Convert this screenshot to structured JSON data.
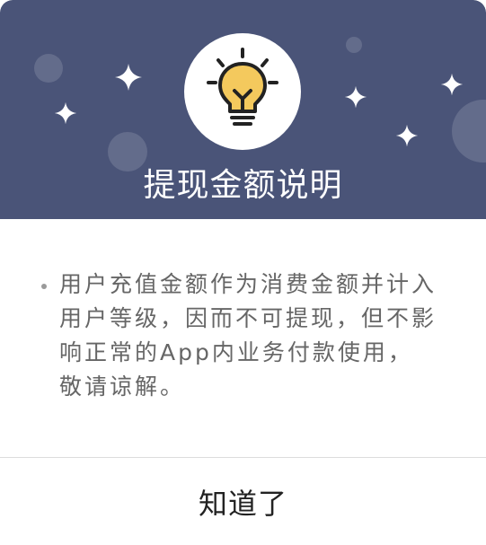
{
  "dialog": {
    "title": "提现金额说明",
    "icon": "lightbulb-icon",
    "bullet_text": "用户充值金额作为消费金额并计入用户等级，因而不可提现，但不影响正常的App内业务付款使用，敬请谅解。",
    "confirm_label": "知道了"
  },
  "colors": {
    "header_bg": "#4a5478",
    "bulb_fill": "#f4c95d",
    "text_gray": "#666666"
  }
}
